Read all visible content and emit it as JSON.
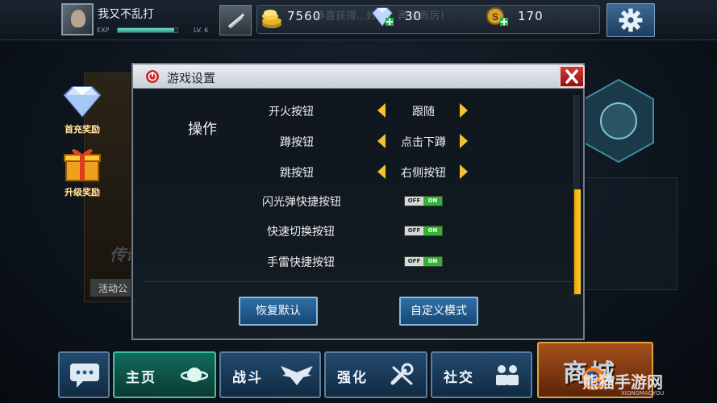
{
  "player": {
    "name": "我又不乱打",
    "exp_label": "EXP",
    "exp_fraction": 0.95,
    "level": "LV. 6"
  },
  "resources": {
    "gold": "7560",
    "diamonds": "30",
    "silver": "170",
    "ticker_text": "恭喜获得...好运，再接再厉！"
  },
  "sidebar": [
    {
      "label": "首充奖励",
      "icon": "diamond-icon"
    },
    {
      "label": "升级奖励",
      "icon": "gift-icon"
    }
  ],
  "background": {
    "activity_label": "活动公",
    "promo_text": "传奇"
  },
  "dialog": {
    "title": "游戏设置",
    "section": "操作",
    "options": [
      {
        "label": "开火按钮",
        "value": "跟随"
      },
      {
        "label": "蹲按钮",
        "value": "点击下蹲"
      },
      {
        "label": "跳按钮",
        "value": "右侧按钮"
      }
    ],
    "toggles": [
      {
        "label": "闪光弹快捷按钮",
        "off": "OFF",
        "on": "ON",
        "state": "on"
      },
      {
        "label": "快速切换按钮",
        "off": "OFF",
        "on": "ON",
        "state": "on"
      },
      {
        "label": "手雷快捷按钮",
        "off": "OFF",
        "on": "ON",
        "state": "on"
      }
    ],
    "reset_label": "恢复默认",
    "custom_label": "自定义模式"
  },
  "nav": {
    "home": "主页",
    "battle": "战斗",
    "upgrade": "强化",
    "social": "社交",
    "shop": "商城"
  },
  "watermark": {
    "text": "熊猫手游网",
    "sub": "XIONGMAOYOU"
  },
  "colors": {
    "accent_orange": "#ffcc33",
    "toggle_on": "#2fb52f",
    "close_red": "#d13b3b",
    "button_blue": "#2f6fa8"
  }
}
